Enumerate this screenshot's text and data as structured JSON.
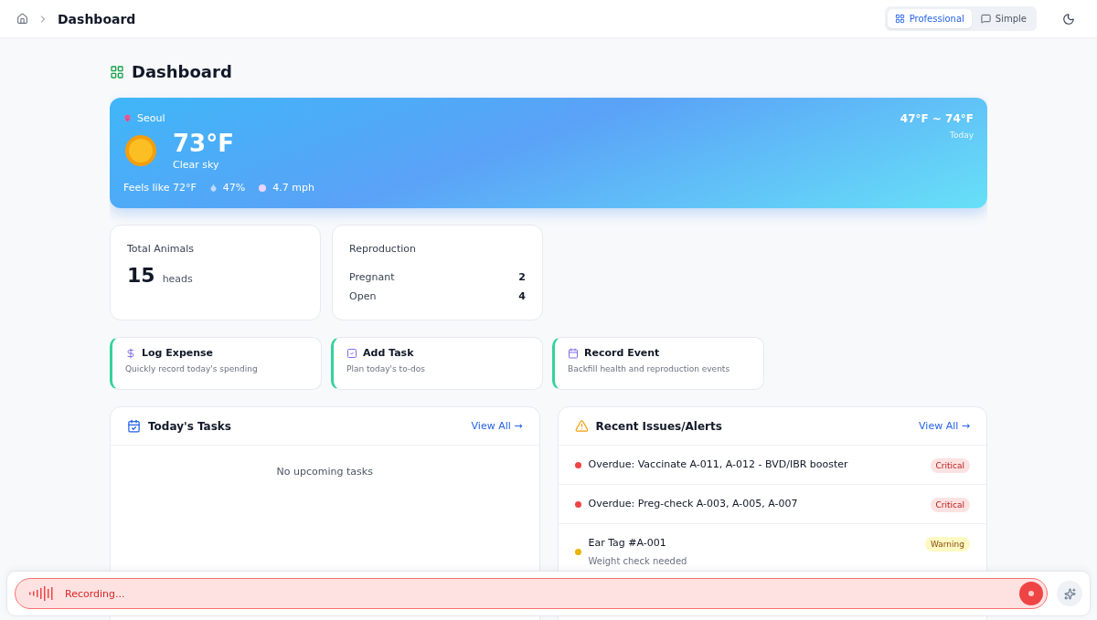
{
  "breadcrumb": {
    "current": "Dashboard"
  },
  "modes": [
    {
      "label": "Professional",
      "selected": true
    },
    {
      "label": "Simple",
      "selected": false
    }
  ],
  "page_title": "Dashboard",
  "weather": {
    "city": "Seoul",
    "temp": "73°F",
    "condition": "Clear sky",
    "feels_like": "Feels like 72°F",
    "humidity": "47%",
    "wind": "4.7 mph",
    "range": "47°F ~ 74°F",
    "day": "Today"
  },
  "stats": [
    {
      "kind": "total",
      "title": "Total Animals",
      "value": "15",
      "unit": "heads"
    },
    {
      "kind": "list",
      "title": "Reproduction",
      "rows": [
        {
          "label": "Pregnant",
          "value": "2"
        },
        {
          "label": "Open",
          "value": "4"
        }
      ]
    }
  ],
  "actions": [
    {
      "kind": "expense",
      "title": "Log Expense",
      "subtitle": "Quickly record today's spending"
    },
    {
      "kind": "task",
      "title": "Add Task",
      "subtitle": "Plan today's to-dos"
    },
    {
      "kind": "event",
      "title": "Record Event",
      "subtitle": "Backfill health and reproduction events"
    }
  ],
  "tasks": {
    "title": "Today's Tasks",
    "link": "View All →",
    "empty": "No upcoming tasks"
  },
  "alerts": {
    "title": "Recent Issues/Alerts",
    "link": "View All →",
    "items": [
      {
        "kind": "critical",
        "color": "#ef4444",
        "text": "Overdue: Vaccinate A-011, A-012 - BVD/IBR booster",
        "badge": "Critical"
      },
      {
        "kind": "critical",
        "color": "#ef4444",
        "text": "Overdue: Preg-check A-003, A-005, A-007",
        "badge": "Critical"
      },
      {
        "kind": "warning",
        "color": "#eab308",
        "text": "Ear Tag #A-001",
        "detail": "Weight check needed",
        "badge": "Warning"
      }
    ]
  },
  "recorder": {
    "status": "Recording..."
  }
}
